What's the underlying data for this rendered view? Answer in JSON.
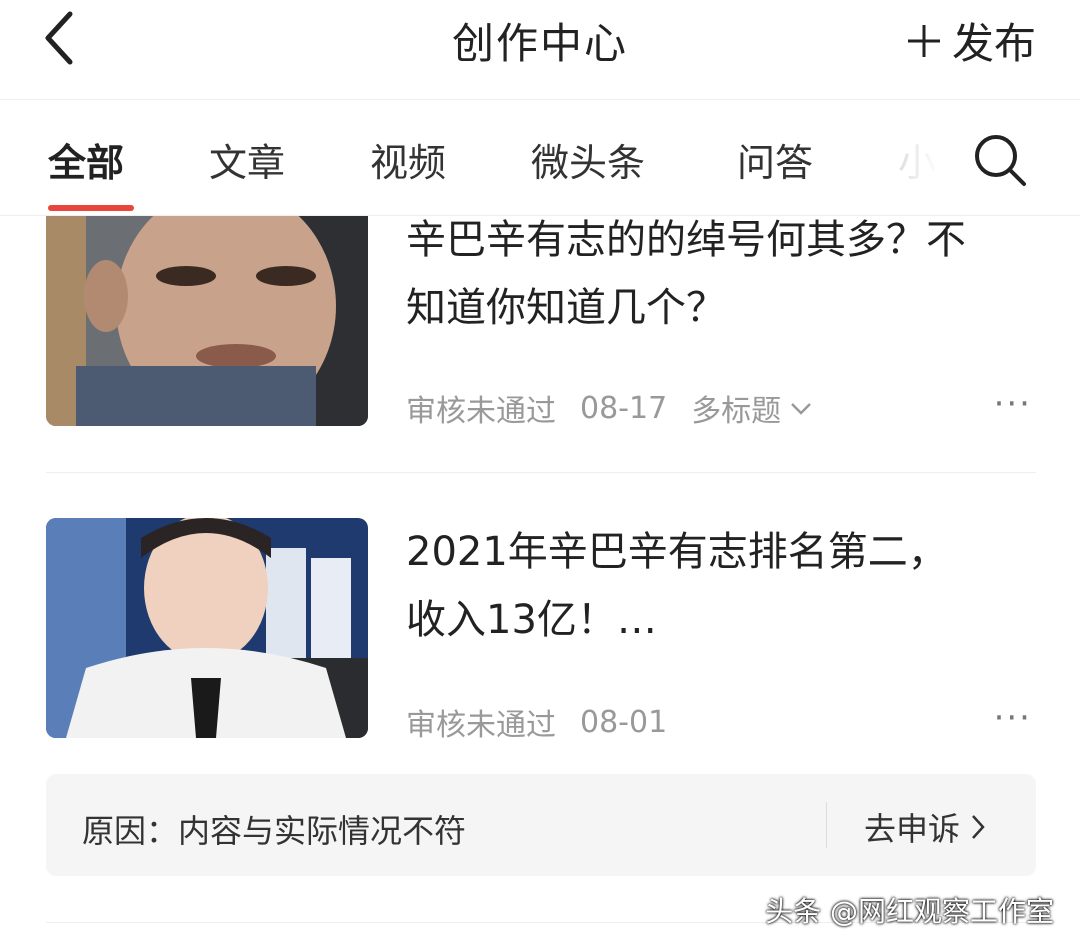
{
  "header": {
    "title": "创作中心",
    "publish_label": "发布",
    "back_icon": "chevron-left-icon"
  },
  "tabs": [
    {
      "label": "全部",
      "active": true
    },
    {
      "label": "文章",
      "active": false
    },
    {
      "label": "视频",
      "active": false
    },
    {
      "label": "微头条",
      "active": false
    },
    {
      "label": "问答",
      "active": false
    },
    {
      "label": "小",
      "active": false
    }
  ],
  "accent_color": "#e8453c",
  "articles": [
    {
      "title": "辛巴辛有志的的绰号何其多？不知道你知道几个？",
      "status": "审核未通过",
      "date": "08-17",
      "tag": "多标题",
      "more": "···"
    },
    {
      "title": "2021年辛巴辛有志排名第二，收入13亿！…",
      "status": "审核未通过",
      "date": "08-01",
      "more": "···"
    }
  ],
  "reason": {
    "text": "原因：内容与实际情况不符",
    "appeal_label": "去申诉"
  },
  "watermark": "头条 @网红观察工作室"
}
